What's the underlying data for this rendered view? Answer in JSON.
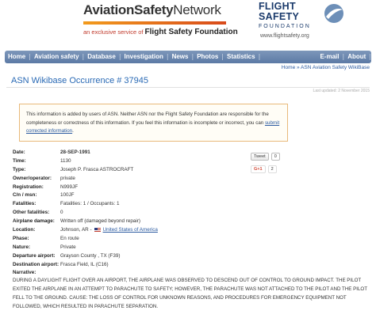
{
  "header": {
    "asn_title_part1": "Aviation",
    "asn_title_part2": "Safety",
    "asn_title_part3": "Network",
    "asn_subtitle_prefix": "an exclusive service of",
    "asn_subtitle_org": "Flight Safety Foundation",
    "fsf_line1": "FLIGHT",
    "fsf_line2": "SAFETY",
    "fsf_foundation": "FOUNDATION",
    "fsf_url": "www.flightsafety.org",
    "brand_orange": "#f29b1d",
    "brand_navy": "#1a3a6b"
  },
  "nav": {
    "items": [
      "Home",
      "Aviation safety",
      "Database",
      "Investigation",
      "News",
      "Photos",
      "Statistics"
    ],
    "right_items": [
      "E-mail",
      "About"
    ]
  },
  "breadcrumb": "Home » ASN Aviation Safety WikiBase",
  "page_title": "ASN Wikibase Occurrence # 37945",
  "last_updated": "Last updated: 2 November 2015",
  "disclaimer": {
    "text": "This information is added by users of ASN. Neither ASN nor the Flight Safety Foundation are responsible for the completeness or correctness of this information. If you feel this information is incomplete or incorrect, you can",
    "link": "submit corrected information",
    "end": "."
  },
  "social": {
    "tweet_label": "Tweet",
    "tweet_count": "0",
    "gplus_label": "G+1",
    "gplus_count": "2"
  },
  "record": {
    "date_label": "Date:",
    "date": "28-SEP-1991",
    "time_label": "Time:",
    "time": "1130",
    "type_label": "Type:",
    "type": "Joseph P. Frasca ASTROCRAFT",
    "owner_label": "Owner/operator:",
    "owner": "private",
    "reg_label": "Registration:",
    "reg": "N999JF",
    "cn_label": "C/n / msn:",
    "cn": "100JF",
    "fatalities_label": "Fatalities:",
    "fatalities": "Fatalities: 1 / Occupants: 1",
    "other_fatalities_label": "Other fatalities:",
    "other_fatalities": "0",
    "damage_label": "Airplane damage:",
    "damage": "Written off (damaged beyond repair)",
    "location_label": "Location:",
    "location": "Johnson, AR -",
    "location_country": "United States of America",
    "phase_label": "Phase:",
    "phase": "En route",
    "nature_label": "Nature:",
    "nature": "Private",
    "departure_label": "Departure airport:",
    "departure": "Grayson County , TX (F39)",
    "destination_label": "Destination airport:",
    "destination": "Frasca Field, IL (C16)",
    "narrative_label": "Narrative:",
    "narrative": "DURING A DAYLIGHT FLIGHT OVER AN AIRPORT, THE AIRPLANE WAS OBSERVED TO DESCEND OUT OF CONTROL TO GROUND IMPACT. THE PILOT EXITED THE AIRPLANE IN AN ATTEMPT TO PARACHUTE TO SAFETY; HOWEVER, THE PARACHUTE WAS NOT ATTACHED TO THE PILOT AND THE PILOT FELL TO THE GROUND. CAUSE: THE LOSS OF CONTROL FOR UNKNOWN REASONS, AND PROCEDURES FOR EMERGENCY EQUIPMENT NOT FOLLOWED, WHICH RESULTED IN PARACHUTE SEPARATION."
  }
}
